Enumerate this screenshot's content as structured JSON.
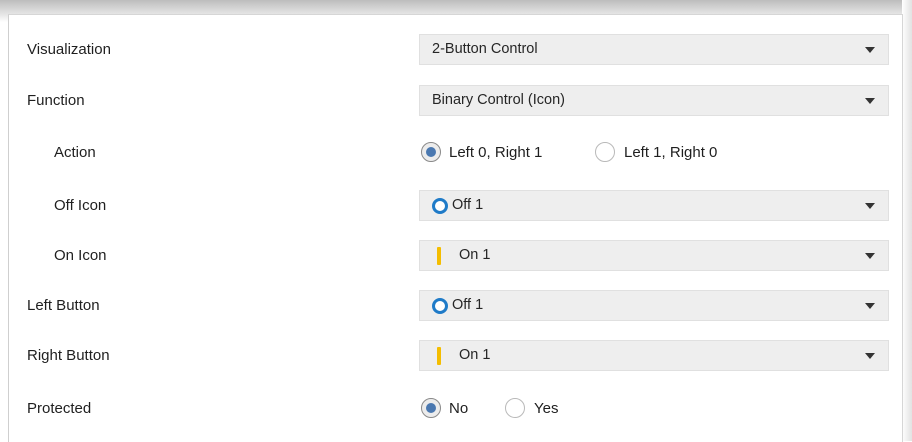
{
  "rows": {
    "visualization": {
      "label": "Visualization",
      "value": "2-Button Control"
    },
    "function": {
      "label": "Function",
      "value": "Binary Control (Icon)"
    },
    "action": {
      "label": "Action",
      "options": [
        {
          "label": "Left 0, Right 1",
          "checked": true
        },
        {
          "label": "Left 1, Right 0",
          "checked": false
        }
      ]
    },
    "off_icon": {
      "label": "Off Icon",
      "value": "Off 1",
      "icon": "ring-icon"
    },
    "on_icon": {
      "label": "On Icon",
      "value": "On 1",
      "icon": "bar-icon"
    },
    "left_button": {
      "label": "Left Button",
      "value": "Off 1",
      "icon": "ring-icon"
    },
    "right_button": {
      "label": "Right Button",
      "value": "On 1",
      "icon": "bar-icon"
    },
    "protected": {
      "label": "Protected",
      "options": [
        {
          "label": "No",
          "checked": true
        },
        {
          "label": "Yes",
          "checked": false
        }
      ]
    }
  },
  "colors": {
    "ring_icon": "#1f7bc8",
    "bar_icon": "#f4bd00",
    "radio_selected": "#4a78b0",
    "combo_background": "#eeeeee"
  }
}
